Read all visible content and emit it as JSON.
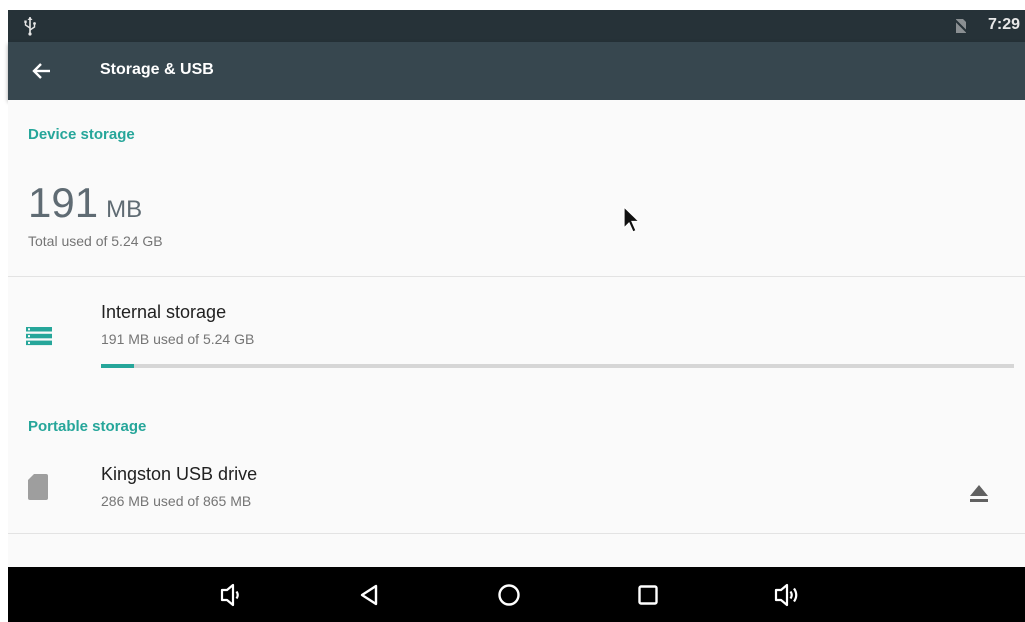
{
  "status_bar": {
    "clock": "7:29",
    "icons": [
      "usb-icon",
      "no-sim-icon"
    ]
  },
  "app_bar": {
    "title": "Storage & USB",
    "back_icon": "arrow-back-icon"
  },
  "device_storage": {
    "header": "Device storage",
    "used_value": "191",
    "used_unit": "MB",
    "caption": "Total used of 5.24 GB"
  },
  "internal_storage": {
    "title": "Internal storage",
    "summary": "191 MB used of 5.24 GB",
    "icon": "storage-icon",
    "used_fraction": 0.036
  },
  "portable_storage": {
    "header": "Portable storage",
    "items": [
      {
        "title": "Kingston USB drive",
        "summary": "286 MB used of 865 MB",
        "icon": "sd-card-icon",
        "action_icon": "eject-icon"
      }
    ]
  },
  "nav_bar": {
    "buttons": [
      "volume-down-icon",
      "back-icon",
      "home-icon",
      "recents-icon",
      "volume-up-icon"
    ]
  },
  "colors": {
    "accent": "#26a69a",
    "status_bar": "#263238",
    "app_bar": "#37474f",
    "nav_bar": "#000000"
  }
}
